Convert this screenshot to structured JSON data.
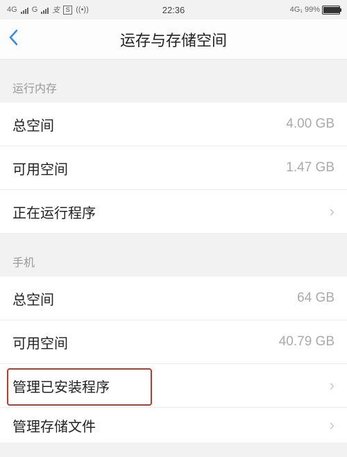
{
  "status": {
    "net1": "4G",
    "net2": "G",
    "icon_s": "S",
    "wifi_like": "((•))",
    "time": "22:36",
    "right_net": "4G₁",
    "battery_pct": "99%"
  },
  "header": {
    "title": "运存与存储空间"
  },
  "sections": {
    "ram": {
      "title": "运行内存",
      "total_label": "总空间",
      "total_value": "4.00 GB",
      "avail_label": "可用空间",
      "avail_value": "1.47 GB",
      "running_label": "正在运行程序"
    },
    "phone": {
      "title": "手机",
      "total_label": "总空间",
      "total_value": "64 GB",
      "avail_label": "可用空间",
      "avail_value": "40.79 GB",
      "manage_apps_label": "管理已安装程序",
      "manage_files_label": "管理存储文件"
    }
  }
}
